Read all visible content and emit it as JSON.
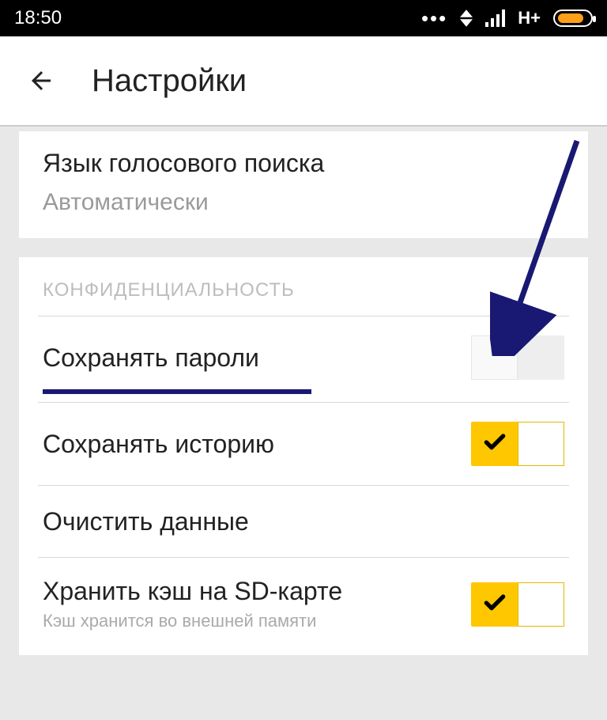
{
  "status": {
    "time": "18:50",
    "network_type": "H+"
  },
  "header": {
    "title": "Настройки"
  },
  "voice_search": {
    "title": "Язык голосового поиска",
    "value": "Автоматически"
  },
  "privacy": {
    "section_title": "КОНФИДЕНЦИАЛЬНОСТЬ",
    "items": [
      {
        "label": "Сохранять пароли",
        "toggle": "off",
        "highlighted": true
      },
      {
        "label": "Сохранять историю",
        "toggle": "on"
      },
      {
        "label": "Очистить данные"
      },
      {
        "label": "Хранить кэш на SD-карте",
        "sub": "Кэш хранится во внешней памяти",
        "toggle": "on"
      }
    ]
  },
  "annotation": {
    "arrow_color": "#191973"
  }
}
